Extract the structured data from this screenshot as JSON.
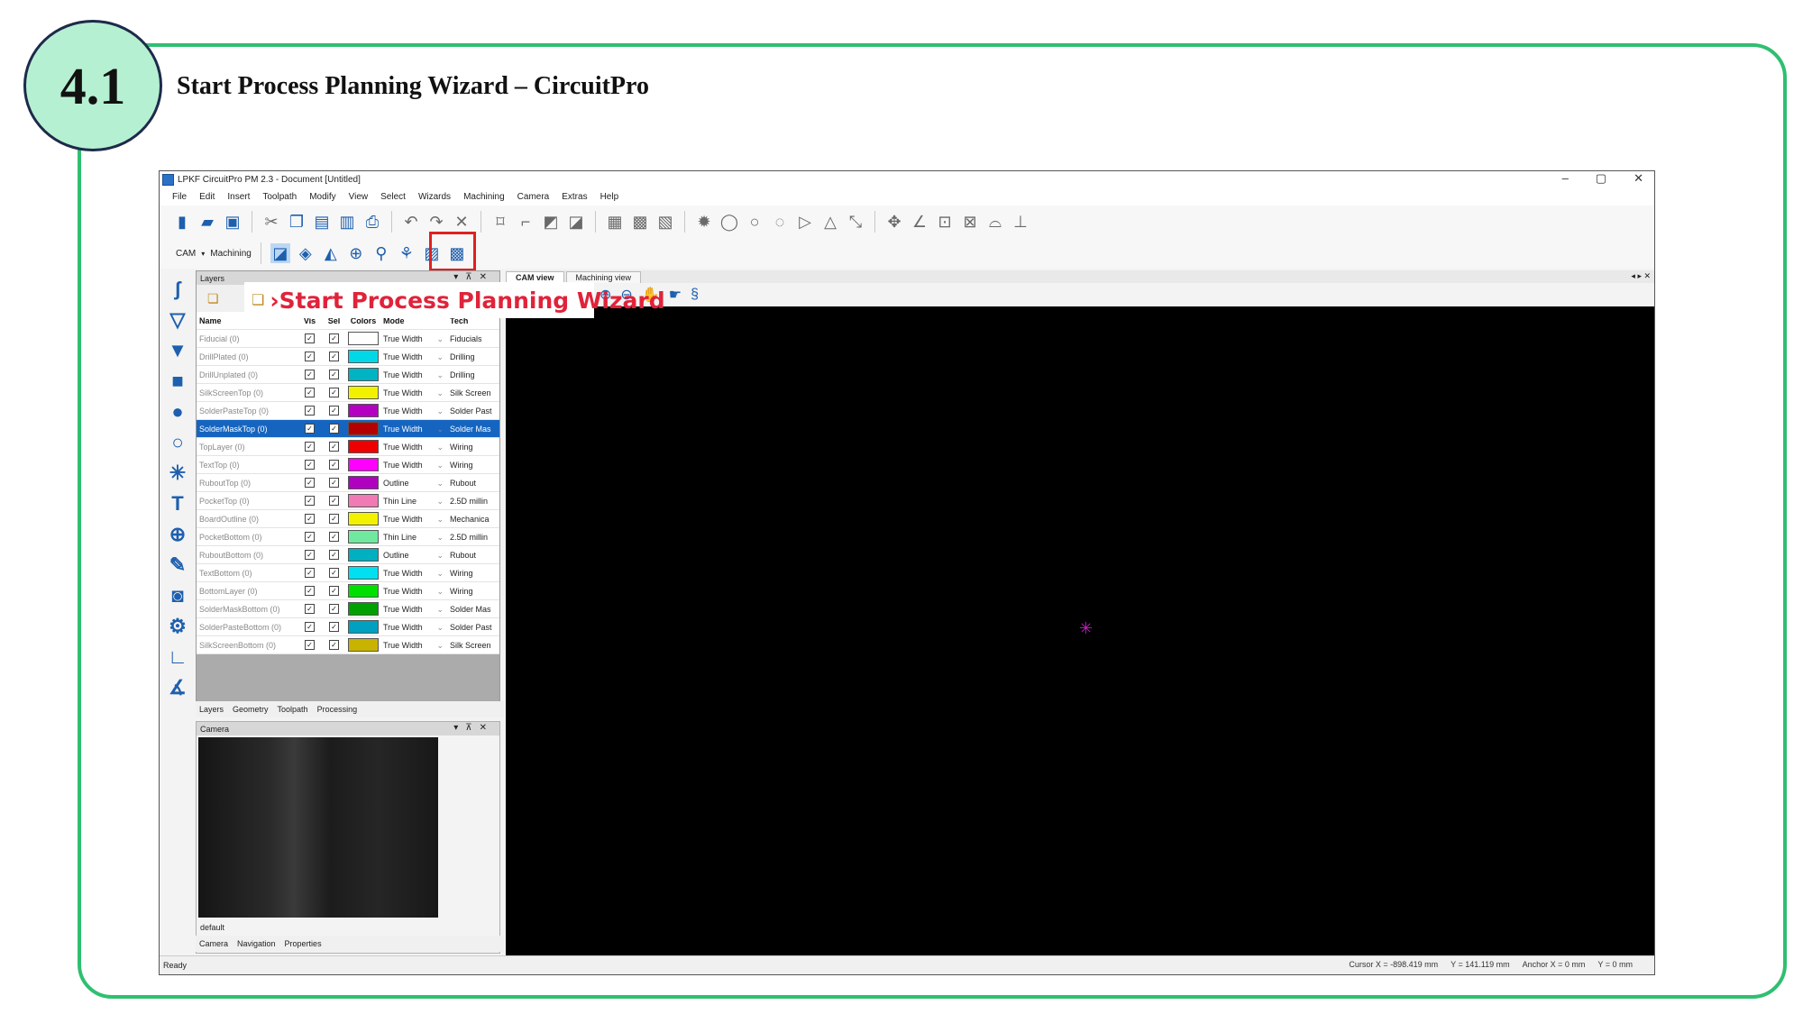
{
  "slide": {
    "number": "4.1",
    "title": "Start Process Planning Wizard – CircuitPro",
    "frame_color": "#2fbf71",
    "badge_color": "#b6f0d2"
  },
  "app": {
    "title": "LPKF CircuitPro PM 2.3 - Document [Untitled]",
    "window_controls": [
      "–",
      "▢",
      "✕"
    ],
    "menu": [
      "File",
      "Edit",
      "Insert",
      "Toolpath",
      "Modify",
      "View",
      "Select",
      "Wizards",
      "Machining",
      "Camera",
      "Extras",
      "Help"
    ],
    "toolbar2": {
      "cam_label": "CAM",
      "machining_label": "Machining"
    },
    "tooltip": "›Start Process Planning Wizard",
    "layers_panel": {
      "title": "Layers",
      "columns": [
        "Name",
        "Vis",
        "Sel",
        "Colors",
        "Mode",
        "Tech"
      ],
      "rows": [
        {
          "name": "Fiducial (0)",
          "color": "#ffffff",
          "mode": "True Width",
          "tech": "Fiducials"
        },
        {
          "name": "DrillPlated (0)",
          "color": "#00d8e8",
          "mode": "True Width",
          "tech": "Drilling"
        },
        {
          "name": "DrillUnplated (0)",
          "color": "#00b4c4",
          "mode": "True Width",
          "tech": "Drilling"
        },
        {
          "name": "SilkScreenTop (0)",
          "color": "#f2f200",
          "mode": "True Width",
          "tech": "Silk Screen"
        },
        {
          "name": "SolderPasteTop (0)",
          "color": "#b400c0",
          "mode": "True Width",
          "tech": "Solder Past"
        },
        {
          "name": "SolderMaskTop (0)",
          "color": "#b40000",
          "mode": "True Width",
          "tech": "Solder Mas",
          "selected": true
        },
        {
          "name": "TopLayer (0)",
          "color": "#ee0000",
          "mode": "True Width",
          "tech": "Wiring"
        },
        {
          "name": "TextTop (0)",
          "color": "#ff00ff",
          "mode": "True Width",
          "tech": "Wiring"
        },
        {
          "name": "RuboutTop (0)",
          "color": "#b000c0",
          "mode": "Outline",
          "tech": "Rubout"
        },
        {
          "name": "PocketTop (0)",
          "color": "#f07ab4",
          "mode": "Thin Line",
          "tech": "2.5D millin"
        },
        {
          "name": "BoardOutline (0)",
          "color": "#f2f200",
          "mode": "True Width",
          "tech": "Mechanica"
        },
        {
          "name": "PocketBottom (0)",
          "color": "#70e8a0",
          "mode": "Thin Line",
          "tech": "2.5D millin"
        },
        {
          "name": "RuboutBottom (0)",
          "color": "#00b0c0",
          "mode": "Outline",
          "tech": "Rubout"
        },
        {
          "name": "TextBottom (0)",
          "color": "#00e0f0",
          "mode": "True Width",
          "tech": "Wiring"
        },
        {
          "name": "BottomLayer (0)",
          "color": "#00e000",
          "mode": "True Width",
          "tech": "Wiring"
        },
        {
          "name": "SolderMaskBottom (0)",
          "color": "#00a000",
          "mode": "True Width",
          "tech": "Solder Mas"
        },
        {
          "name": "SolderPasteBottom (0)",
          "color": "#00a0c0",
          "mode": "True Width",
          "tech": "Solder Past"
        },
        {
          "name": "SilkScreenBottom (0)",
          "color": "#c8b400",
          "mode": "True Width",
          "tech": "Silk Screen"
        }
      ],
      "tabs": [
        "Layers",
        "Geometry",
        "Toolpath",
        "Processing"
      ]
    },
    "camera_panel": {
      "title": "Camera",
      "label": "default",
      "tabs": [
        "Camera",
        "Navigation",
        "Properties"
      ]
    },
    "doc_tabs": [
      "CAM view",
      "Machining view"
    ],
    "status": {
      "left": "Ready",
      "cursor_x": "Cursor X = -898.419 mm",
      "cursor_y": "Y = 141.119 mm",
      "anchor_x": "Anchor X = 0 mm",
      "anchor_y": "Y = 0 mm"
    }
  }
}
